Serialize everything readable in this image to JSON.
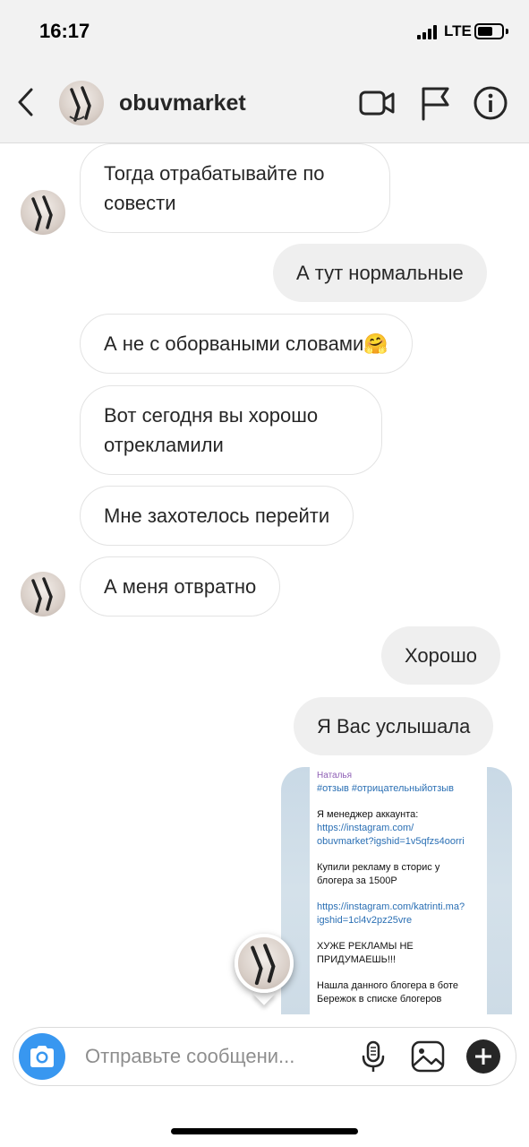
{
  "status_bar": {
    "time": "16:17",
    "network": "LTE",
    "battery_level": 0.65
  },
  "header": {
    "username": "obuvmarket"
  },
  "messages": [
    {
      "direction": "incoming",
      "text_lines": [
        "Тогда отрабатывайте по",
        "совести"
      ]
    },
    {
      "direction": "outgoing",
      "text_lines": [
        "А тут нормальные"
      ]
    },
    {
      "direction": "incoming",
      "text_lines": [
        "А не с оборваными словами🤗"
      ]
    },
    {
      "direction": "incoming",
      "text_lines": [
        "Вот сегодня вы хорошо",
        "отрекламили"
      ]
    },
    {
      "direction": "incoming",
      "text_lines": [
        "Мне захотелось перейти"
      ]
    },
    {
      "direction": "incoming",
      "text_lines": [
        "А меня отвратно"
      ]
    },
    {
      "direction": "outgoing",
      "text_lines": [
        "Хорошо"
      ]
    },
    {
      "direction": "outgoing",
      "text_lines": [
        "Я Вас услышала"
      ]
    }
  ],
  "shared_post": {
    "author": "Наталья",
    "hashtags": "#отзыв #отрицательныйотзыв",
    "line1": "Я менеджер аккаунта:",
    "link1a": "https://instagram.com/",
    "link1b": "obuvmarket?igshid=1v5qfzs4oorri",
    "line2a": "Купили рекламу в сторис у",
    "line2b": "блогера за 1500Р",
    "link2a": "https://instagram.com/katrinti.ma?",
    "link2b": "igshid=1cl4v2pz25vre",
    "line3a": "ХУЖЕ РЕКЛАМЫ НЕ",
    "line3b": "ПРИДУМАЕШЬ!!!",
    "line4a": "Нашла данного блогера в боте",
    "line4b": "Бережок в списке блогеров"
  },
  "composer": {
    "placeholder": "Отправьте сообщени..."
  },
  "colors": {
    "accent": "#3897f0",
    "outgoing_bubble": "#efefef",
    "incoming_border": "#e3e3e3",
    "link": "#2a6fb4"
  }
}
